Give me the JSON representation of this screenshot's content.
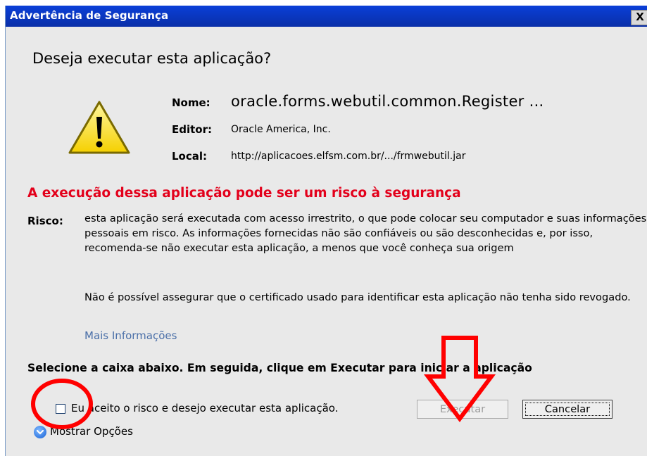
{
  "window": {
    "title": "Advertência de Segurança",
    "close_glyph": "X"
  },
  "question": "Deseja executar esta aplicação?",
  "details": {
    "name_label": "Nome:",
    "name_value": "oracle.forms.webutil.common.Register ...",
    "publisher_label": "Editor:",
    "publisher_value": "Oracle America, Inc.",
    "location_label": "Local:",
    "location_value": "http://aplicacoes.elfsm.com.br/.../frmwebutil.jar"
  },
  "risk": {
    "heading": "A execução dessa aplicação pode ser um risco à segurança",
    "label": "Risco:",
    "text": "esta aplicação será executada com acesso irrestrito, o que pode colocar seu computador e suas informações pessoais em risco. As informações fornecidas não são confiáveis ou são desconhecidas e, por isso, recomenda-se não executar esta aplicação, a menos que você conheça sua origem",
    "revocation_text": "Não é possível assegurar que o certificado usado para identificar esta aplicação não tenha sido revogado.",
    "more_info_link": "Mais Informações"
  },
  "instruction": "Selecione a caixa abaixo. Em seguida, clique em Executar para iniciar a aplicação",
  "accept_checkbox": {
    "label": "Eu aceito o risco e desejo executar esta aplicação.",
    "checked": false
  },
  "buttons": {
    "run": "Executar",
    "run_enabled": false,
    "cancel": "Cancelar"
  },
  "show_options": "Mostrar Opções",
  "colors": {
    "titlebar": "#0a3fd8",
    "risk_heading": "#e3001b",
    "annotation": "#ff0000",
    "link": "#4a6fa8",
    "dialog_bg": "#e9e9e9"
  },
  "icons": {
    "warning": "warning-triangle-icon",
    "options": "chevron-down-circle-icon"
  }
}
